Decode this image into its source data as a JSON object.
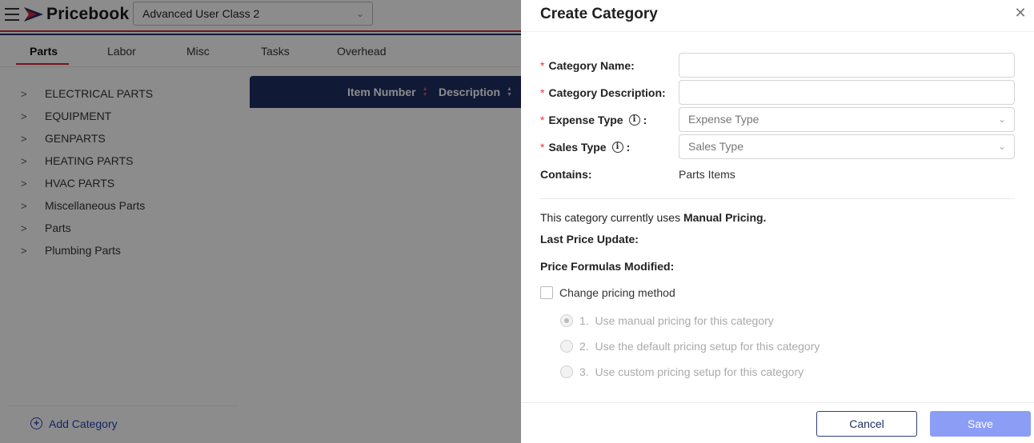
{
  "app": {
    "name": "Pricebook",
    "class_select": {
      "value": "Advanced User Class 2"
    },
    "tabs": [
      {
        "label": "Parts",
        "active": true
      },
      {
        "label": "Labor"
      },
      {
        "label": "Misc"
      },
      {
        "label": "Tasks"
      },
      {
        "label": "Overhead"
      }
    ],
    "categories": [
      "ELECTRICAL PARTS",
      "EQUIPMENT",
      "GENPARTS",
      "HEATING PARTS",
      "HVAC PARTS",
      "Miscellaneous Parts",
      "Parts",
      "Plumbing Parts"
    ],
    "add_category_label": "Add Category",
    "table_headers": [
      "Item Number",
      "Description"
    ],
    "colors": {
      "header_navy": "#1e2f63",
      "accent_red": "#d6253a"
    }
  },
  "drawer": {
    "title": "Create Category",
    "fields": {
      "category_name_label": "Category Name",
      "category_description_label": "Category Description",
      "expense_type_label": "Expense Type",
      "expense_type_placeholder": "Expense Type",
      "sales_type_label": "Sales Type",
      "sales_type_placeholder": "Sales Type",
      "contains_label": "Contains",
      "contains_value": "Parts Items"
    },
    "pricing": {
      "uses_prefix": "This category currently uses",
      "method": "Manual Pricing.",
      "last_price_update_label": "Last Price Update",
      "formulas_modified_label": "Price Formulas Modified",
      "change_method_label": "Change pricing method",
      "options": [
        "1.  Use manual pricing for this category",
        "2.  Use the default pricing setup for this category",
        "3.  Use custom pricing setup for this category"
      ]
    },
    "footer": {
      "cancel_label": "Cancel",
      "save_label": "Save"
    }
  }
}
